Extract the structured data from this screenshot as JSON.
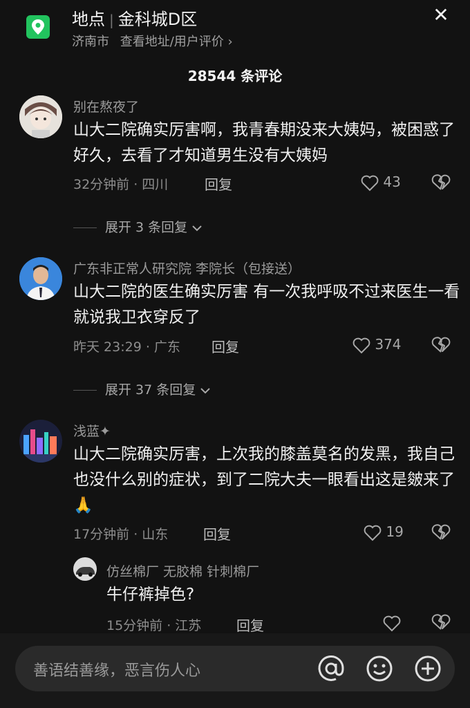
{
  "header": {
    "prefix": "地点",
    "place": "金科城D区",
    "city": "济南市",
    "links": "查看地址/用户评价",
    "chevron": "›",
    "close": "✕"
  },
  "comment_count": "28544 条评论",
  "comments": [
    {
      "user": "别在熬夜了",
      "text": "山大二院确实厉害啊，我青春期没来大姨妈，被困惑了好久，去看了才知道男生没有大姨妈",
      "meta": "32分钟前 · 四川",
      "reply": "回复",
      "likes": "43",
      "expand": "展开 3 条回复"
    },
    {
      "user": "广东非正常人研究院 李院长（包接送）",
      "text": "山大二院的医生确实厉害 有一次我呼吸不过来医生一看就说我卫衣穿反了",
      "meta": "昨天 23:29 · 广东",
      "reply": "回复",
      "likes": "374",
      "expand": "展开 37 条回复"
    },
    {
      "user": "浅蓝✦",
      "text": "山大二院确实厉害，上次我的膝盖莫名的发黑，我自己也没什么别的症状，到了二院大夫一眼看出这是皴来了🙏",
      "meta": "17分钟前 · 山东",
      "reply": "回复",
      "likes": "19"
    }
  ],
  "subreply": {
    "user": "仿丝棉厂 无胶棉 针刺棉厂",
    "text": "牛仔裤掉色?",
    "meta": "15分钟前 · 江苏",
    "reply": "回复"
  },
  "input": {
    "placeholder": "善语结善缘，恶言伤人心"
  },
  "icons": {
    "location": "location-pin-icon",
    "like": "heart-icon",
    "dislike": "broken-heart-icon",
    "expand": "chevron-down-icon",
    "mention": "at-icon",
    "emoji": "smile-icon",
    "add": "plus-circle-icon"
  },
  "colors": {
    "background": "#121212",
    "accent": "#22c35e"
  }
}
